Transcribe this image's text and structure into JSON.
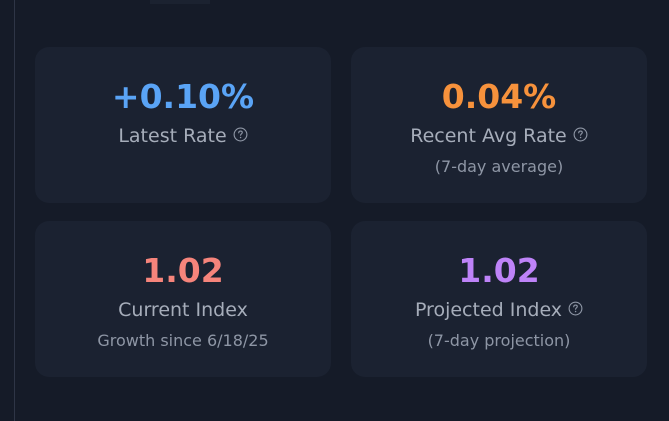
{
  "colors": {
    "background": "#151b28",
    "card": "#1b2231",
    "blue": "#5aa4f6",
    "orange": "#f7923c",
    "salmon": "#f6847b",
    "purple": "#be83f8",
    "label": "#a6adba",
    "subtext": "#8e96a5"
  },
  "cards": [
    {
      "value": "+0.10%",
      "label": "Latest Rate",
      "has_help_icon": true,
      "subtext": ""
    },
    {
      "value": "0.04%",
      "label": "Recent Avg Rate",
      "has_help_icon": true,
      "subtext": "(7-day average)"
    },
    {
      "value": "1.02",
      "label": "Current Index",
      "has_help_icon": false,
      "subtext": "Growth since 6/18/25"
    },
    {
      "value": "1.02",
      "label": "Projected Index",
      "has_help_icon": true,
      "subtext": "(7-day projection)"
    }
  ],
  "icons": {
    "help": "question-circle-icon"
  }
}
